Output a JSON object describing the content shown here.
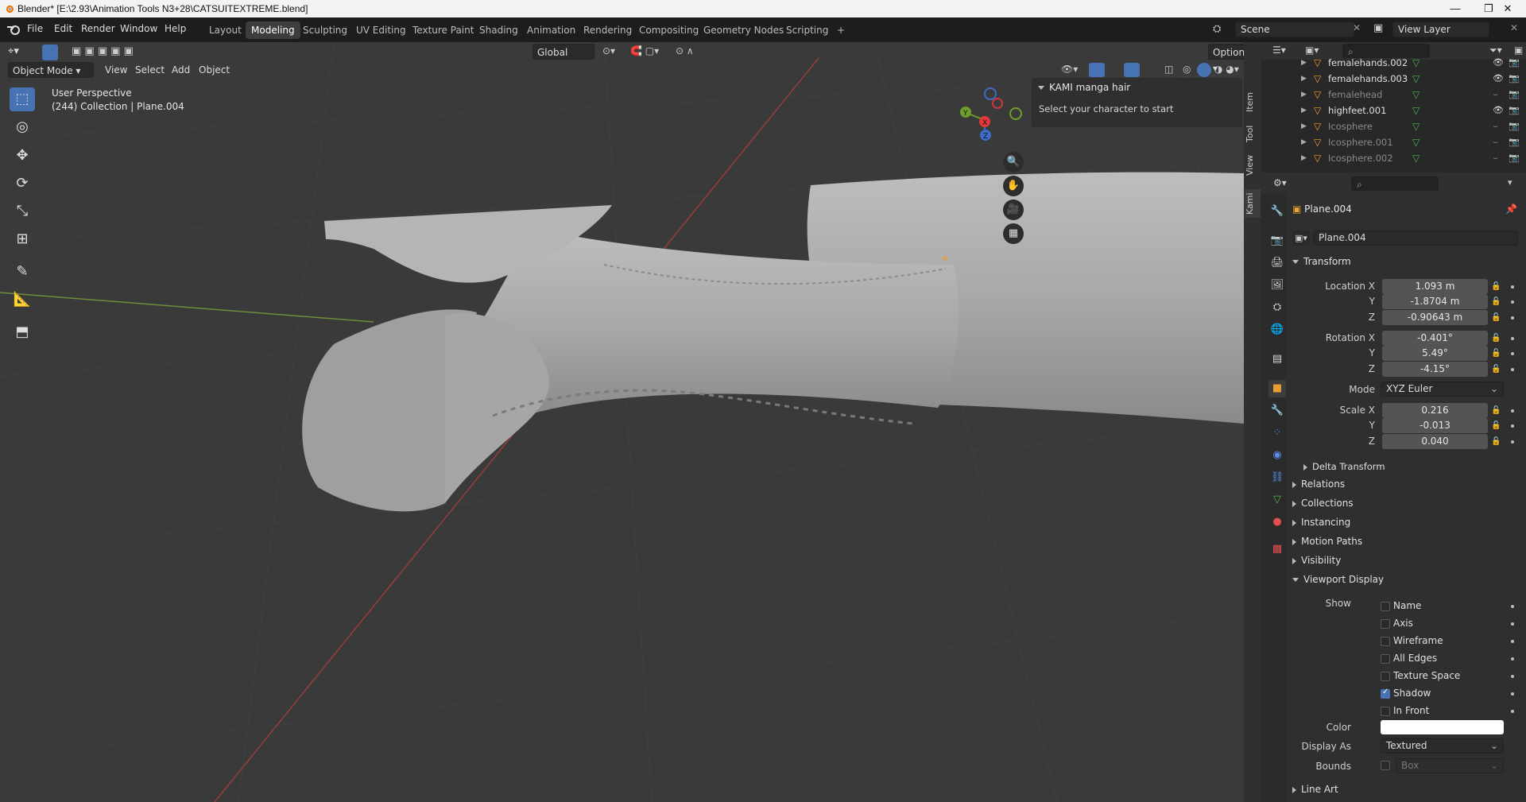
{
  "window": {
    "title": "Blender* [E:\\2.93\\Animation Tools N3+28\\CATSUITEXTREME.blend]",
    "min": "—",
    "max": "❐",
    "close": "✕"
  },
  "menu": [
    "File",
    "Edit",
    "Render",
    "Window",
    "Help"
  ],
  "workspaces": [
    "Layout",
    "Modeling",
    "Sculpting",
    "UV Editing",
    "Texture Paint",
    "Shading",
    "Animation",
    "Rendering",
    "Compositing",
    "Geometry Nodes",
    "Scripting",
    "+"
  ],
  "active_workspace": "Modeling",
  "scene": {
    "label": "Scene",
    "view_layer": "View Layer"
  },
  "viewport": {
    "mode": "Object Mode",
    "menus": [
      "View",
      "Select",
      "Add",
      "Object"
    ],
    "orientation": "Global",
    "options": "Options",
    "perspective": "User Perspective",
    "collection_info": "(244) Collection | Plane.004",
    "gizmo": {
      "x": "X",
      "y": "Y",
      "z": "Z"
    }
  },
  "npanel": {
    "title": "KAMI manga hair",
    "text": "Select your character to start",
    "tabs": [
      "Item",
      "Tool",
      "View",
      "Kami"
    ]
  },
  "outliner": {
    "items": [
      {
        "name": "femalehands.002",
        "dim": false
      },
      {
        "name": "femalehands.003",
        "dim": false
      },
      {
        "name": "femalehead",
        "dim": true
      },
      {
        "name": "highfeet.001",
        "dim": false
      },
      {
        "name": "Icosphere",
        "dim": true
      },
      {
        "name": "Icosphere.001",
        "dim": true
      },
      {
        "name": "Icosphere.002",
        "dim": true
      }
    ]
  },
  "properties": {
    "object_name": "Plane.004",
    "object_field": "Plane.004",
    "transform_title": "Transform",
    "location": {
      "label_x": "Location X",
      "x": "1.093 m",
      "y": "-1.8704 m",
      "z": "-0.90643 m"
    },
    "rotation": {
      "label_x": "Rotation X",
      "x": "-0.401°",
      "y": "5.49°",
      "z": "-4.15°"
    },
    "mode_label": "Mode",
    "mode_value": "XYZ Euler",
    "scale": {
      "label_x": "Scale X",
      "x": "0.216",
      "y": "-0.013",
      "z": "0.040"
    },
    "axis_y": "Y",
    "axis_z": "Z",
    "delta_transform": "Delta Transform",
    "sections": [
      "Relations",
      "Collections",
      "Instancing",
      "Motion Paths",
      "Visibility"
    ],
    "viewport_display": "Viewport Display",
    "show_label": "Show",
    "show_items": [
      {
        "label": "Name",
        "checked": false
      },
      {
        "label": "Axis",
        "checked": false
      },
      {
        "label": "Wireframe",
        "checked": false
      },
      {
        "label": "All Edges",
        "checked": false
      },
      {
        "label": "Texture Space",
        "checked": false
      },
      {
        "label": "Shadow",
        "checked": true
      },
      {
        "label": "In Front",
        "checked": false
      }
    ],
    "color_label": "Color",
    "display_as_label": "Display As",
    "display_as_value": "Textured",
    "bounds_label": "Bounds",
    "bounds_value": "Box",
    "line_art": "Line Art"
  },
  "colors": {
    "accent": "#4772b3",
    "viewport_bg": "#3a3a3a",
    "mesh": "#a9a9a9"
  }
}
